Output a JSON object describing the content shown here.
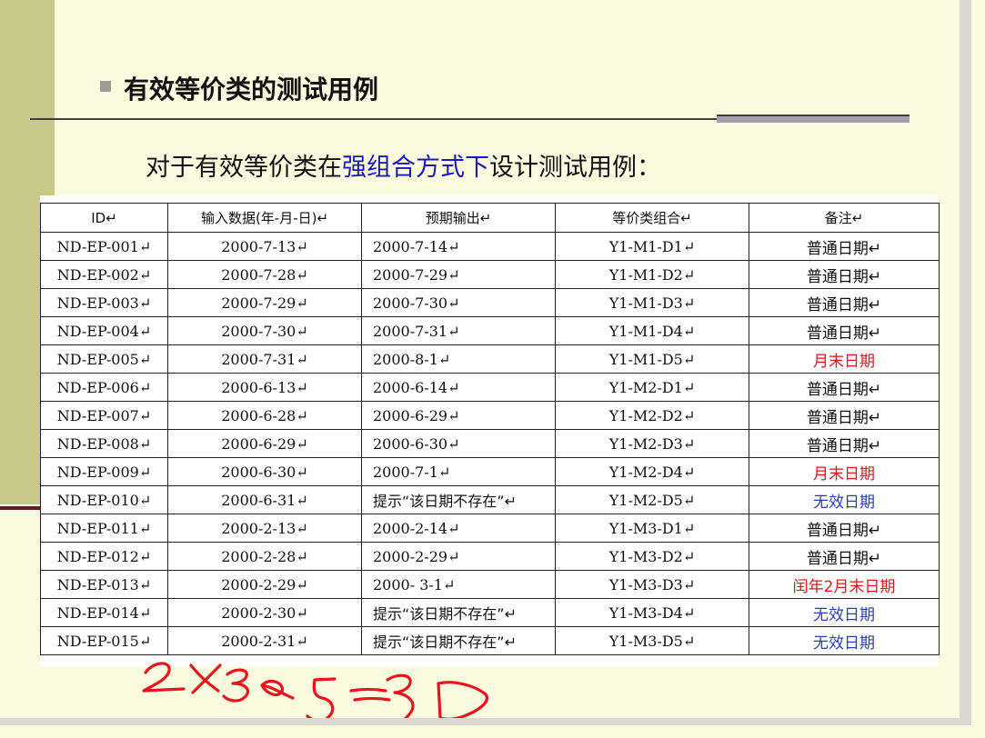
{
  "slide": {
    "heading": "有效等价类的测试用例",
    "subtitle_pre": "对于有效等价类在",
    "subtitle_emphasis": "强组合方式下",
    "subtitle_post": "设计测试用例："
  },
  "table": {
    "headers": [
      "ID↵",
      "输入数据(年-月-日)↵",
      "预期输出↵",
      "等价类组合↵",
      "备注↵"
    ],
    "rows": [
      {
        "id": "ND-EP-001↵",
        "input": "2000-7-13↵",
        "output": "2000-7-14↵",
        "combo": "Y1-M1-D1↵",
        "note": "普通日期↵",
        "note_type": "normal"
      },
      {
        "id": "ND-EP-002↵",
        "input": "2000-7-28↵",
        "output": "2000-7-29↵",
        "combo": "Y1-M1-D2↵",
        "note": "普通日期↵",
        "note_type": "normal"
      },
      {
        "id": "ND-EP-003↵",
        "input": "2000-7-29↵",
        "output": "2000-7-30↵",
        "combo": "Y1-M1-D3↵",
        "note": "普通日期↵",
        "note_type": "normal"
      },
      {
        "id": "ND-EP-004↵",
        "input": "2000-7-30↵",
        "output": "2000-7-31↵",
        "combo": "Y1-M1-D4↵",
        "note": "普通日期↵",
        "note_type": "normal"
      },
      {
        "id": "ND-EP-005↵",
        "input": "2000-7-31↵",
        "output": "2000-8-1↵",
        "combo": "Y1-M1-D5↵",
        "note": "月末日期",
        "note_type": "month"
      },
      {
        "id": "ND-EP-006↵",
        "input": "2000-6-13↵",
        "output": "2000-6-14↵",
        "combo": "Y1-M2-D1↵",
        "note": "普通日期↵",
        "note_type": "normal"
      },
      {
        "id": "ND-EP-007↵",
        "input": "2000-6-28↵",
        "output": "2000-6-29↵",
        "combo": "Y1-M2-D2↵",
        "note": "普通日期↵",
        "note_type": "normal"
      },
      {
        "id": "ND-EP-008↵",
        "input": "2000-6-29↵",
        "output": "2000-6-30↵",
        "combo": "Y1-M2-D3↵",
        "note": "普通日期↵",
        "note_type": "normal"
      },
      {
        "id": "ND-EP-009↵",
        "input": "2000-6-30↵",
        "output": "2000-7-1↵",
        "combo": "Y1-M2-D4↵",
        "note": "月末日期",
        "note_type": "month"
      },
      {
        "id": "ND-EP-010↵",
        "input": "2000-6-31↵",
        "output": "提示“该日期不存在”↵",
        "combo": "Y1-M2-D5↵",
        "note": "无效日期",
        "note_type": "invalid"
      },
      {
        "id": "ND-EP-011↵",
        "input": "2000-2-13↵",
        "output": "2000-2-14↵",
        "combo": "Y1-M3-D1↵",
        "note": "普通日期↵",
        "note_type": "normal"
      },
      {
        "id": "ND-EP-012↵",
        "input": "2000-2-28↵",
        "output": "2000-2-29↵",
        "combo": "Y1-M3-D2↵",
        "note": "普通日期↵",
        "note_type": "normal"
      },
      {
        "id": "ND-EP-013↵",
        "input": "2000-2-29↵",
        "output": "2000- 3-1↵",
        "combo": "Y1-M3-D3↵",
        "note": "闰年2月末日期",
        "note_type": "leap"
      },
      {
        "id": "ND-EP-014↵",
        "input": "2000-2-30↵",
        "output": "提示“该日期不存在”↵",
        "combo": "Y1-M3-D4↵",
        "note": "无效日期",
        "note_type": "invalid"
      },
      {
        "id": "ND-EP-015↵",
        "input": "2000-2-31↵",
        "output": "提示“该日期不存在”↵",
        "combo": "Y1-M3-D5↵",
        "note": "无效日期",
        "note_type": "invalid"
      }
    ]
  },
  "annotation": {
    "handwritten": "2×3×5=30",
    "color": "#e8141e"
  },
  "colors": {
    "background": "#fbfbe0",
    "left_bar": "#c9c78a",
    "emphasis_text": "#1a1ab8",
    "month_end_note": "#e0161d",
    "invalid_note": "#2a3fb0"
  }
}
